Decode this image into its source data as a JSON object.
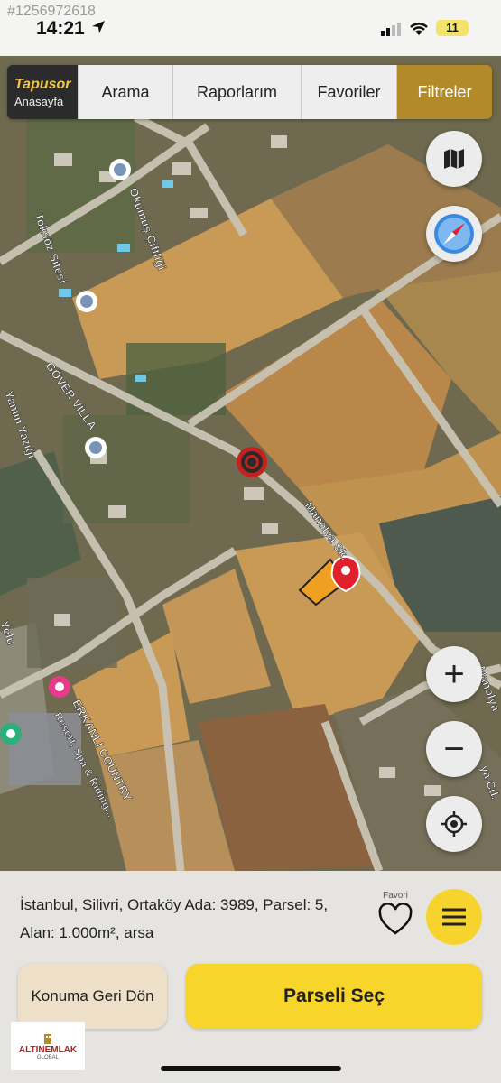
{
  "status": {
    "image_id": "#1256972618",
    "time": "14:21",
    "battery": "11"
  },
  "nav": {
    "brand_name": "Tapusor",
    "brand_sub": "Anasayfa",
    "tabs": [
      {
        "label": "Arama",
        "active": false
      },
      {
        "label": "Raporlarım",
        "active": false
      },
      {
        "label": "Favoriler",
        "active": false
      },
      {
        "label": "Filtreler",
        "active": true
      }
    ]
  },
  "map": {
    "labels": {
      "okumus": "Okumuş Çiftliği",
      "toksoz": "Toksöz Sitesi",
      "gover": "GÖVER VİLLA",
      "mamin": "Yamin Yazığı",
      "manolya": "Manolya Sk.",
      "erkanli": "ERKANLI COUNTRY",
      "erkanli2": "Resort, Spa & Riding...",
      "yolu": "Yolu",
      "manolya_right": "Manolya",
      "cd": "ya Cd."
    },
    "controls": {
      "layers_icon": "map-layers-icon",
      "compass_icon": "compass-icon",
      "zoom_in": "+",
      "zoom_out": "−",
      "locate_icon": "crosshair-icon"
    },
    "colors": {
      "parcel": "#f0a020",
      "pin": "#e0202a"
    }
  },
  "sheet": {
    "parcel_info": "İstanbul, Silivri, Ortaköy Ada: 3989, Parsel: 5, Alan: 1.000m², arsa",
    "favorite_label": "Favori",
    "back_button": "Konuma Geri Dön",
    "select_button": "Parseli Seç"
  },
  "logo": {
    "name": "ALTINEMLAK",
    "sub": "GLOBAL"
  }
}
